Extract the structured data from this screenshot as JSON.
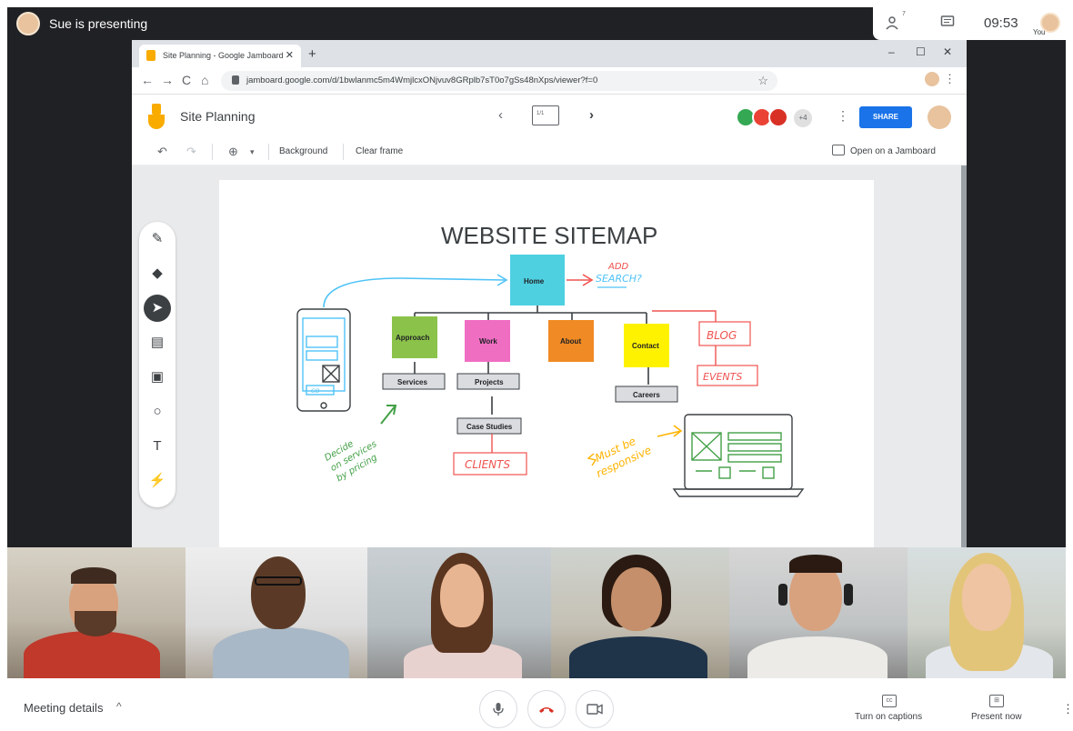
{
  "top_bar": {
    "presenter_label": "Sue is presenting",
    "clock": "09:53",
    "self_label": "You",
    "people_count": "7",
    "icons": [
      "people-icon",
      "chat-icon"
    ]
  },
  "browser": {
    "tab_title": "Site Planning - Google Jamboard",
    "tab_close": "✕",
    "new_tab": "+",
    "window_controls": [
      "–",
      "☐",
      "✕"
    ],
    "nav_icons": [
      "←",
      "→",
      "C",
      "⌂"
    ],
    "url": "jamboard.google.com/d/1bwlanmc5m4WmjlcxONjvuv8GRplb7sT0o7gSs48nXps/viewer?f=0",
    "star": "☆",
    "menu": "⋮"
  },
  "jamboard": {
    "title": "Site Planning",
    "prev": "‹",
    "next": "›",
    "frame_indicator": "1/1",
    "more_collaborators": "+4",
    "header_menu": "⋮",
    "share_label": "SHARE",
    "toolbar": {
      "undo": "↶",
      "redo": "↷",
      "zoom": "⊕",
      "zoom_dropdown": "▾",
      "background_label": "Background",
      "clear_frame_label": "Clear frame",
      "open_on_jamboard_label": "Open on a Jamboard"
    },
    "side_tools": [
      {
        "name": "pen-tool",
        "glyph": "✎"
      },
      {
        "name": "eraser-tool",
        "glyph": "◆"
      },
      {
        "name": "select-tool",
        "glyph": "➤"
      },
      {
        "name": "sticky-note-tool",
        "glyph": "▤"
      },
      {
        "name": "image-tool",
        "glyph": "▣"
      },
      {
        "name": "shape-tool",
        "glyph": "○"
      },
      {
        "name": "text-box-tool",
        "glyph": "T"
      },
      {
        "name": "laser-tool",
        "glyph": "⚡"
      }
    ],
    "sitemap": {
      "title": "WEBSITE SITEMAP",
      "home": "Home",
      "approach": "Approach",
      "work": "Work",
      "about": "About",
      "contact": "Contact",
      "services": "Services",
      "projects": "Projects",
      "case_studies": "Case Studies",
      "careers": "Careers",
      "add_search_1": "ADD",
      "add_search_2": "SEARCH?",
      "blog": "BLOG",
      "events": "EVENTS",
      "clients": "CLIENTS",
      "decide_1": "Decide",
      "decide_2": "on services",
      "decide_3": "by pricing",
      "must_1": "Must be",
      "must_2": "responsive",
      "phone_go": "GO",
      "colors": {
        "home": "#4ed0e0",
        "approach": "#8bc34a",
        "work": "#f06ec2",
        "about": "#f08a24",
        "contact": "#fff200"
      }
    }
  },
  "participants": [
    {
      "name": "participant-1"
    },
    {
      "name": "participant-2"
    },
    {
      "name": "participant-3"
    },
    {
      "name": "participant-4"
    },
    {
      "name": "participant-5"
    },
    {
      "name": "participant-6"
    }
  ],
  "bottom_bar": {
    "meeting_details": "Meeting details",
    "chevron": "^",
    "mic": "🎙",
    "hangup": "☎",
    "camera": "▭",
    "captions_icon": "cc",
    "captions_label": "Turn on captions",
    "present_icon": "⊞",
    "present_label": "Present now",
    "menu": "⋮"
  }
}
